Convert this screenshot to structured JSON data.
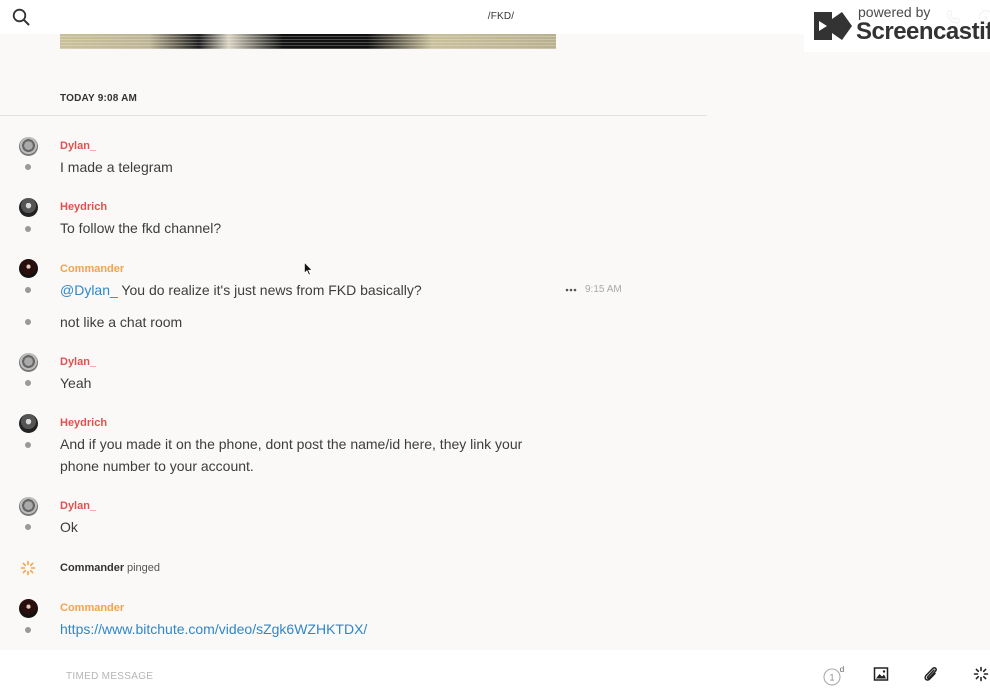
{
  "header": {
    "channel_title": "/FKD/"
  },
  "watermark": {
    "line1": "powered by",
    "line2": "Screencastify"
  },
  "date_divider": "TODAY 9:08 AM",
  "messages": [
    {
      "user": "Dylan_",
      "avatar": "dylan-avatar",
      "text": "I made a telegram"
    },
    {
      "user": "Heydrich",
      "avatar": "heydrich-avatar",
      "text": "To follow the fkd channel?"
    },
    {
      "user": "Commander",
      "avatar": "commander-avatar",
      "mention": "@Dylan_",
      "text": " You do realize it's just news from FKD basically?",
      "time": "9:15 AM"
    },
    {
      "text": "not like a chat room"
    },
    {
      "user": "Dylan_",
      "avatar": "dylan-avatar",
      "text": "Yeah"
    },
    {
      "user": "Heydrich",
      "avatar": "heydrich-avatar",
      "text_line1": "And if you made it on the phone, dont post the name/id here, they link your",
      "text_line2": "phone number to your account."
    },
    {
      "user": "Dylan_",
      "avatar": "dylan-avatar",
      "text": "Ok"
    },
    {
      "user": "Commander",
      "avatar": "commander-avatar",
      "link": "https://www.bitchute.com/video/sZgk6WZHKTDX/"
    }
  ],
  "ping_event": {
    "user": "Commander",
    "verb": "pinged",
    "icon": "ping-icon"
  },
  "composer": {
    "placeholder": "TIMED MESSAGE",
    "timer_count": "1",
    "timer_unit": "d"
  },
  "icons": {
    "search": "search-icon",
    "phone": "phone-icon",
    "info": "info-icon",
    "more": "more-icon",
    "image": "image-icon",
    "attach": "paperclip-icon",
    "ping": "ping-icon"
  },
  "colors": {
    "dylan_name": "#e0514f",
    "heydrich_name": "#e0514f",
    "commander_name": "#f5a34b",
    "mention_link": "#2f86c8",
    "ping_accent": "#f5a34b",
    "background": "#faf9f8"
  }
}
